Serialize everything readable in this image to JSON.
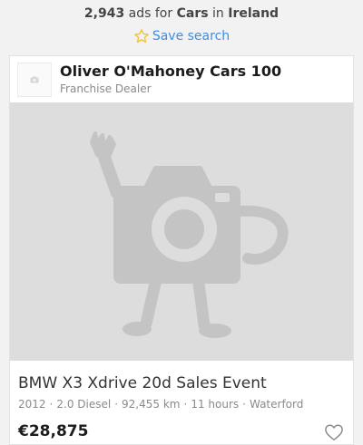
{
  "header": {
    "count": "2,943",
    "text_ads_for": "ads for",
    "category": "Cars",
    "text_in": "in",
    "location": "Ireland",
    "save_search_label": "Save search",
    "save_search_icon": "star-outline-icon"
  },
  "listing": {
    "dealer": {
      "name": "Oliver O'Mahoney Cars 100",
      "type": "Franchise Dealer",
      "logo_icon": "camera-placeholder-icon"
    },
    "image_placeholder_icon": "waving-camera-placeholder",
    "title": "BMW X3 Xdrive 20d Sales Event",
    "meta": [
      "2012",
      "2.0 Diesel",
      "92,455 km",
      "11 hours",
      "Waterford"
    ],
    "meta_separator": "·",
    "price": "€28,875",
    "favourite_icon": "heart-outline-icon"
  },
  "colors": {
    "background": "#f2f2f2",
    "link": "#3d8ee0",
    "star": "#f2c230",
    "placeholder_bg": "#dddddd",
    "placeholder_art": "#c4c4c4"
  }
}
